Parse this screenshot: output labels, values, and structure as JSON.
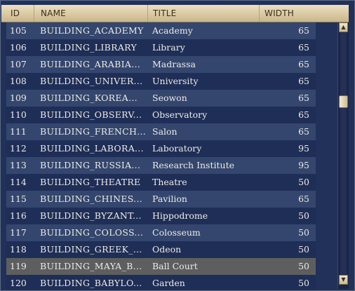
{
  "columns": {
    "id": "ID",
    "name": "NAME",
    "title": "TITLE",
    "width": "WIDTH"
  },
  "rows": [
    {
      "id": "105",
      "name": "BUILDING_ACADEMY",
      "title": "Academy",
      "width": "65"
    },
    {
      "id": "106",
      "name": "BUILDING_LIBRARY",
      "title": "Library",
      "width": "65"
    },
    {
      "id": "107",
      "name": "BUILDING_ARABIA...",
      "title": "Madrassa",
      "width": "65"
    },
    {
      "id": "108",
      "name": "BUILDING_UNIVER...",
      "title": "University",
      "width": "65"
    },
    {
      "id": "109",
      "name": "BUILDING_KOREA...",
      "title": "Seowon",
      "width": "65"
    },
    {
      "id": "110",
      "name": "BUILDING_OBSERV...",
      "title": "Observatory",
      "width": "65"
    },
    {
      "id": "111",
      "name": "BUILDING_FRENCH...",
      "title": "Salon",
      "width": "65"
    },
    {
      "id": "112",
      "name": "BUILDING_LABORA...",
      "title": "Laboratory",
      "width": "95"
    },
    {
      "id": "113",
      "name": "BUILDING_RUSSIA...",
      "title": "Research Institute",
      "width": "95"
    },
    {
      "id": "114",
      "name": "BUILDING_THEATRE",
      "title": "Theatre",
      "width": "50"
    },
    {
      "id": "115",
      "name": "BUILDING_CHINES...",
      "title": "Pavilion",
      "width": "65"
    },
    {
      "id": "116",
      "name": "BUILDING_BYZANT...",
      "title": "Hippodrome",
      "width": "50"
    },
    {
      "id": "117",
      "name": "BUILDING_COLOSS...",
      "title": "Colosseum",
      "width": "50"
    },
    {
      "id": "118",
      "name": "BUILDING_GREEK_...",
      "title": "Odeon",
      "width": "50"
    },
    {
      "id": "119",
      "name": "BUILDING_MAYA_B...",
      "title": "Ball Court",
      "width": "50"
    },
    {
      "id": "120",
      "name": "BUILDING_BABYLO...",
      "title": "Garden",
      "width": "50"
    }
  ],
  "selected_row_id": "119",
  "scrollbar": {
    "up_glyph": "▲",
    "down_glyph": "▼",
    "position_fraction": 0.27
  },
  "colors": {
    "header": "#dac9a2",
    "row_odd": "#34466e",
    "row_even": "#1f2e57",
    "selected": "#5c5f5e",
    "text": "#ecebe5"
  }
}
